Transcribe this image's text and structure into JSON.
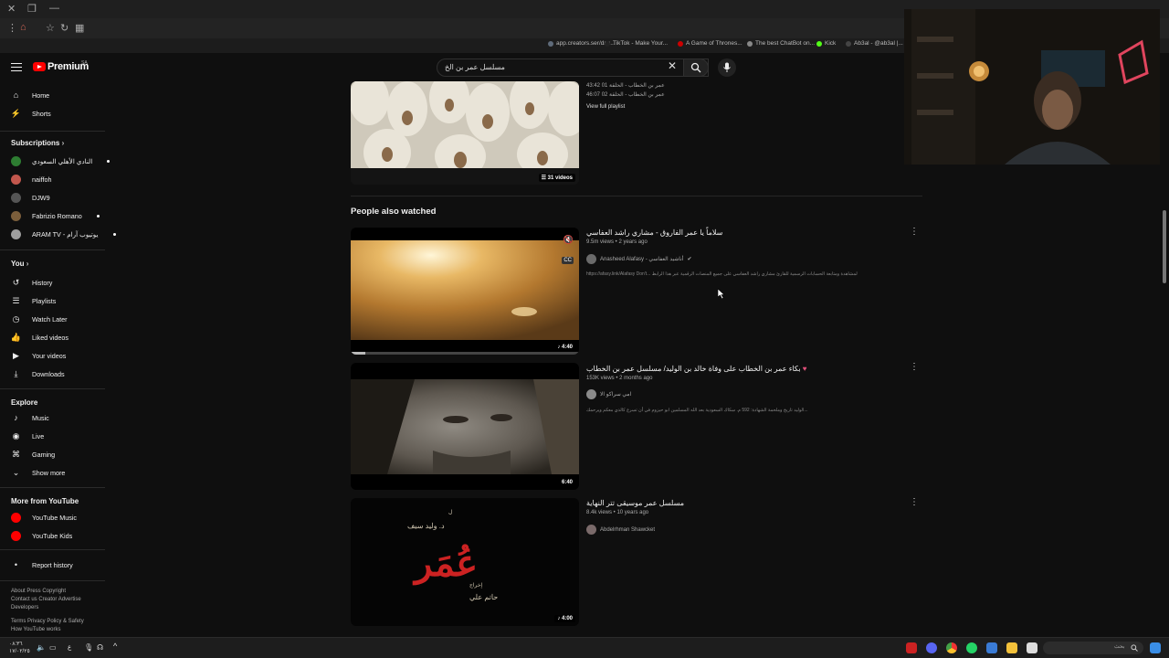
{
  "browser": {
    "bookmarks": [
      {
        "label": "app.creators.ser/das...",
        "color": "#5f6b7a"
      },
      {
        "label": "TikTok - Make Your...",
        "color": "#222222"
      },
      {
        "label": "A Game of Thrones...",
        "color": "#cc0000"
      },
      {
        "label": "The best ChatBot on...",
        "color": "#888888"
      },
      {
        "label": "Kick",
        "color": "#53fc18"
      },
      {
        "label": "Ab3al - @ab3al |...",
        "color": "#444444"
      }
    ]
  },
  "header": {
    "logo_text": "Premium",
    "logo_region": "SA",
    "search_value": "مسلسل عمر بن الخ"
  },
  "sidebar": {
    "main": [
      {
        "label": "Home",
        "icon": "home-icon"
      },
      {
        "label": "Shorts",
        "icon": "shorts-icon"
      }
    ],
    "subscriptions_title": "Subscriptions",
    "subscriptions": [
      {
        "label": "النادي الأهلي السعودي",
        "color": "#2e7d32",
        "live": true
      },
      {
        "label": "naiffoh",
        "color": "#c2574d",
        "live": false
      },
      {
        "label": "DJW9",
        "color": "#555555",
        "live": false
      },
      {
        "label": "Fabrizio Romano",
        "color": "#7b5e3b",
        "live": true
      },
      {
        "label": "ARAM TV - يوتيوب آرام",
        "color": "#9e9e9e",
        "live": true
      }
    ],
    "you_title": "You",
    "you": [
      {
        "label": "History",
        "icon": "history-icon"
      },
      {
        "label": "Playlists",
        "icon": "playlists-icon"
      },
      {
        "label": "Watch Later",
        "icon": "watch-later-icon"
      },
      {
        "label": "Liked videos",
        "icon": "like-icon"
      },
      {
        "label": "Your videos",
        "icon": "your-videos-icon"
      },
      {
        "label": "Downloads",
        "icon": "download-icon"
      }
    ],
    "explore_title": "Explore",
    "explore": [
      {
        "label": "Music",
        "icon": "music-icon"
      },
      {
        "label": "Live",
        "icon": "live-icon"
      },
      {
        "label": "Gaming",
        "icon": "gaming-icon"
      },
      {
        "label": "Show more",
        "icon": "chevron-down-icon"
      }
    ],
    "more_title": "More from YouTube",
    "more": [
      {
        "label": "YouTube Music",
        "color": "#ff0000"
      },
      {
        "label": "YouTube Kids",
        "color": "#ff0000"
      }
    ],
    "report": "Report history",
    "footer1": "About  Press  Copyright\nContact us  Creator  Advertise\nDevelopers",
    "footer2": "Terms  Privacy  Policy & Safety\nHow YouTube works"
  },
  "playlist": {
    "item1_time": "43:42",
    "item1_title": "عمر بن الخطاب - الحلقة 01",
    "item2_time": "46:07",
    "item2_title": "عمر بن الخطاب - الحلقة 02",
    "view_full": "View full playlist",
    "count": "31 videos"
  },
  "section_title": "People also watched",
  "videos": [
    {
      "title": "سلاماً يا عمر الفاروق - مشاري راشد العفاسي",
      "meta": "9.5m views • 2 years ago",
      "channel": "Anasheed Alafasy - أناشيد العفاسي",
      "verified": true,
      "desc": "https://afasy.link/Alafasy Don't... لمشاهدة ومتابعة الحسابات الرسمية للقارئ مشاري راشد العفاسي على جميع المنصات الرقمية عبر هذا الرابط",
      "duration": "4:40",
      "avatar_color": "#6a6a6a"
    },
    {
      "title": "بكاء عمر بن الخطاب على وفاة خالد بن الوليد/ مسلسل عمر بن الخطاب",
      "meta": "153K views • 2 months ago",
      "channel": "امي سراكو الا",
      "verified": false,
      "desc": "الوليد تاريخ وملحمة الشهادة: 592 م. سكاك السعودية بعد الله المسلمين ابو حيزوم في أن تسرع كالذي معكم ويرحمك...",
      "duration": "6:40",
      "avatar_color": "#8a8a8a"
    },
    {
      "title": "مسلسل عمر موسيقى تتر النهاية",
      "meta": "8.4k views • 10 years ago",
      "channel": "Abdelrhman Shawcket",
      "verified": false,
      "desc": "",
      "duration": "4:00",
      "avatar_color": "#7a6a6a"
    }
  ],
  "thumb3_text": {
    "credit_top": "د. وليد سيف",
    "title": "عُمَر",
    "credit_bottom": "حاتم علي",
    "prefix_top": "ل",
    "prefix_bottom": "إخراج"
  },
  "taskbar": {
    "time": "٠٨:٣٦",
    "date": "١٧/٠٢/٢٥",
    "search_placeholder": "بحث",
    "lang": "ع"
  }
}
